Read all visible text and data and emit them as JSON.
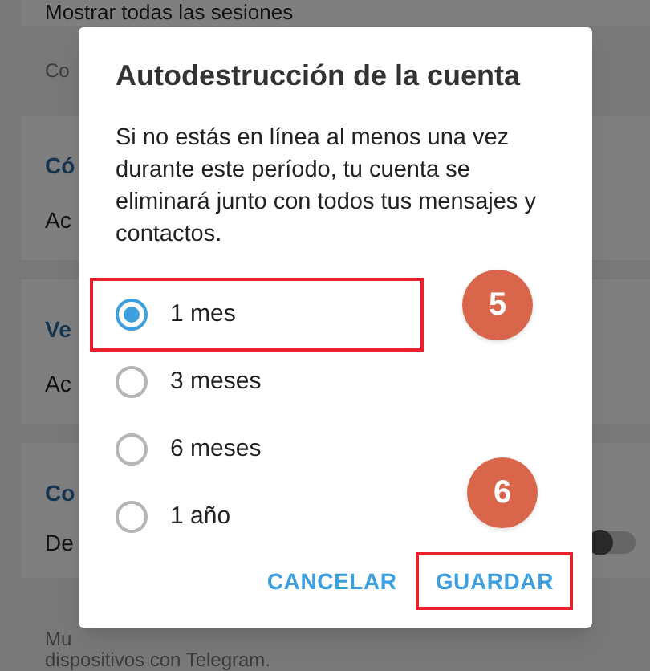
{
  "background": {
    "sections": [
      {
        "kind": "row",
        "text": "Mostrar todas las sesiones"
      },
      {
        "kind": "note",
        "text": "Co"
      },
      {
        "kind": "header",
        "text": "Có"
      },
      {
        "kind": "row",
        "text": "Ac"
      },
      {
        "kind": "gap"
      },
      {
        "kind": "header",
        "text": "Ve"
      },
      {
        "kind": "row",
        "text": "Ac"
      },
      {
        "kind": "gap"
      },
      {
        "kind": "header",
        "text": "Co"
      },
      {
        "kind": "toggle_row",
        "text": "De",
        "on": false
      },
      {
        "kind": "note",
        "text": "Mu"
      },
      {
        "kind": "note",
        "text": "dispositivos con Telegram."
      }
    ]
  },
  "dialog": {
    "title": "Autodestrucción de la cuenta",
    "text": "Si no estás en línea al menos una vez durante este período, tu cuenta se eliminará junto con todos tus mensajes y contactos.",
    "options": [
      {
        "label": "1 mes",
        "selected": true,
        "highlighted": true
      },
      {
        "label": "3 meses",
        "selected": false,
        "highlighted": false
      },
      {
        "label": "6 meses",
        "selected": false,
        "highlighted": false
      },
      {
        "label": "1 año",
        "selected": false,
        "highlighted": false
      }
    ],
    "buttons": [
      {
        "label": "CANCELAR",
        "highlighted": false
      },
      {
        "label": "GUARDAR",
        "highlighted": true
      }
    ]
  },
  "annotations": [
    {
      "text": "5"
    },
    {
      "text": "6"
    }
  ]
}
